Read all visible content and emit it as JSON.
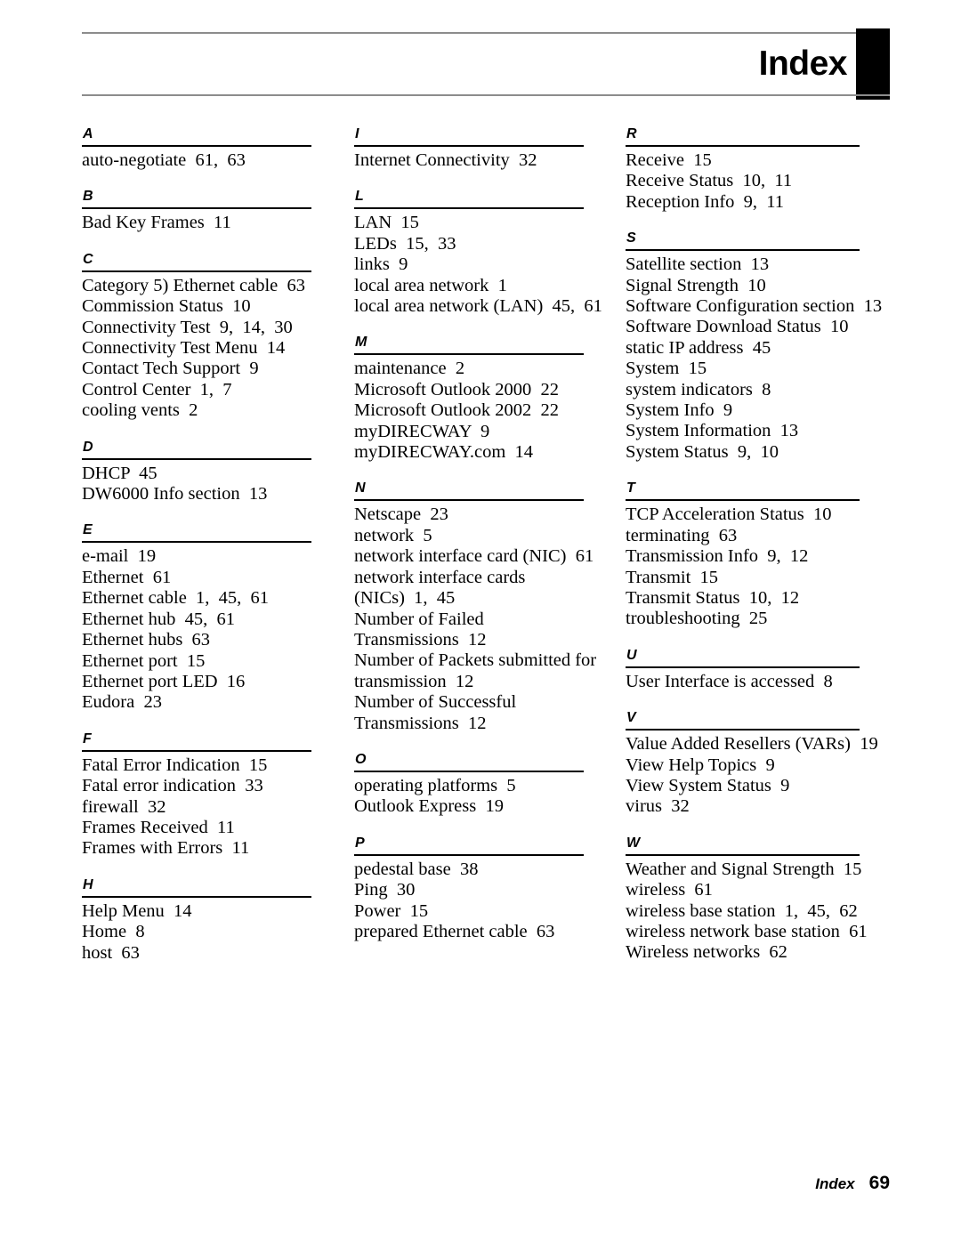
{
  "header": {
    "title": "Index"
  },
  "footer": {
    "label": "Index",
    "page_number": "69"
  },
  "columns": [
    {
      "sections": [
        {
          "letter": "A",
          "entries": [
            "auto-negotiate  61,  63"
          ]
        },
        {
          "letter": "B",
          "entries": [
            "Bad Key Frames  11"
          ]
        },
        {
          "letter": "C",
          "entries": [
            "Category 5) Ethernet cable  63",
            "Commission Status  10",
            "Connectivity Test  9,  14,  30",
            "Connectivity Test Menu  14",
            "Contact Tech Support  9",
            "Control Center  1,  7",
            "cooling vents  2"
          ]
        },
        {
          "letter": "D",
          "entries": [
            "DHCP  45",
            "DW6000 Info section  13"
          ]
        },
        {
          "letter": "E",
          "entries": [
            "e-mail  19",
            "Ethernet  61",
            "Ethernet cable  1,  45,  61",
            "Ethernet hub  45,  61",
            "Ethernet hubs  63",
            "Ethernet port  15",
            "Ethernet port LED  16",
            "Eudora  23"
          ]
        },
        {
          "letter": "F",
          "entries": [
            "Fatal Error Indication  15",
            "Fatal error indication  33",
            "firewall  32",
            "Frames Received  11",
            "Frames with Errors  11"
          ]
        },
        {
          "letter": "H",
          "entries": [
            "Help Menu  14",
            "Home  8",
            "host  63"
          ]
        }
      ]
    },
    {
      "sections": [
        {
          "letter": "I",
          "entries": [
            "Internet Connectivity  32"
          ]
        },
        {
          "letter": "L",
          "entries": [
            "LAN  15",
            "LEDs  15,  33",
            "links  9",
            "local area network  1",
            "local area network (LAN)  45,  61"
          ]
        },
        {
          "letter": "M",
          "entries": [
            "maintenance  2",
            "Microsoft Outlook 2000  22",
            "Microsoft Outlook 2002  22",
            "myDIRECWAY  9",
            "myDIRECWAY.com  14"
          ]
        },
        {
          "letter": "N",
          "entries": [
            "Netscape  23",
            "network  5",
            "network interface card (NIC)  61",
            "network interface cards",
            "(NICs)  1,  45",
            "Number of Failed",
            "Transmissions  12",
            "Number of Packets submitted for",
            "transmission  12",
            "Number of Successful",
            "Transmissions  12"
          ]
        },
        {
          "letter": "O",
          "entries": [
            "operating platforms  5",
            "Outlook Express  19"
          ]
        },
        {
          "letter": "P",
          "entries": [
            "pedestal base  38",
            "Ping  30",
            "Power  15",
            "prepared Ethernet cable  63"
          ]
        }
      ]
    },
    {
      "sections": [
        {
          "letter": "R",
          "entries": [
            "Receive  15",
            "Receive Status  10,  11",
            "Reception Info  9,  11"
          ]
        },
        {
          "letter": "S",
          "entries": [
            "Satellite section  13",
            "Signal Strength  10",
            "Software Configuration section  13",
            "Software Download Status  10",
            "static IP address  45",
            "System  15",
            "system indicators  8",
            "System Info  9",
            "System Information  13",
            "System Status  9,  10"
          ]
        },
        {
          "letter": "T",
          "entries": [
            "TCP Acceleration Status  10",
            "terminating  63",
            "Transmission Info  9,  12",
            "Transmit  15",
            "Transmit Status  10,  12",
            "troubleshooting  25"
          ]
        },
        {
          "letter": "U",
          "entries": [
            "User Interface is accessed  8"
          ]
        },
        {
          "letter": "V",
          "entries": [
            "Value Added Resellers (VARs)  19",
            "View Help Topics  9",
            "View System Status  9",
            "virus  32"
          ]
        },
        {
          "letter": "W",
          "entries": [
            "Weather and Signal Strength  15",
            "wireless  61",
            "wireless base station  1,  45,  62",
            "wireless network base station  61",
            "Wireless networks  62"
          ]
        }
      ]
    }
  ]
}
